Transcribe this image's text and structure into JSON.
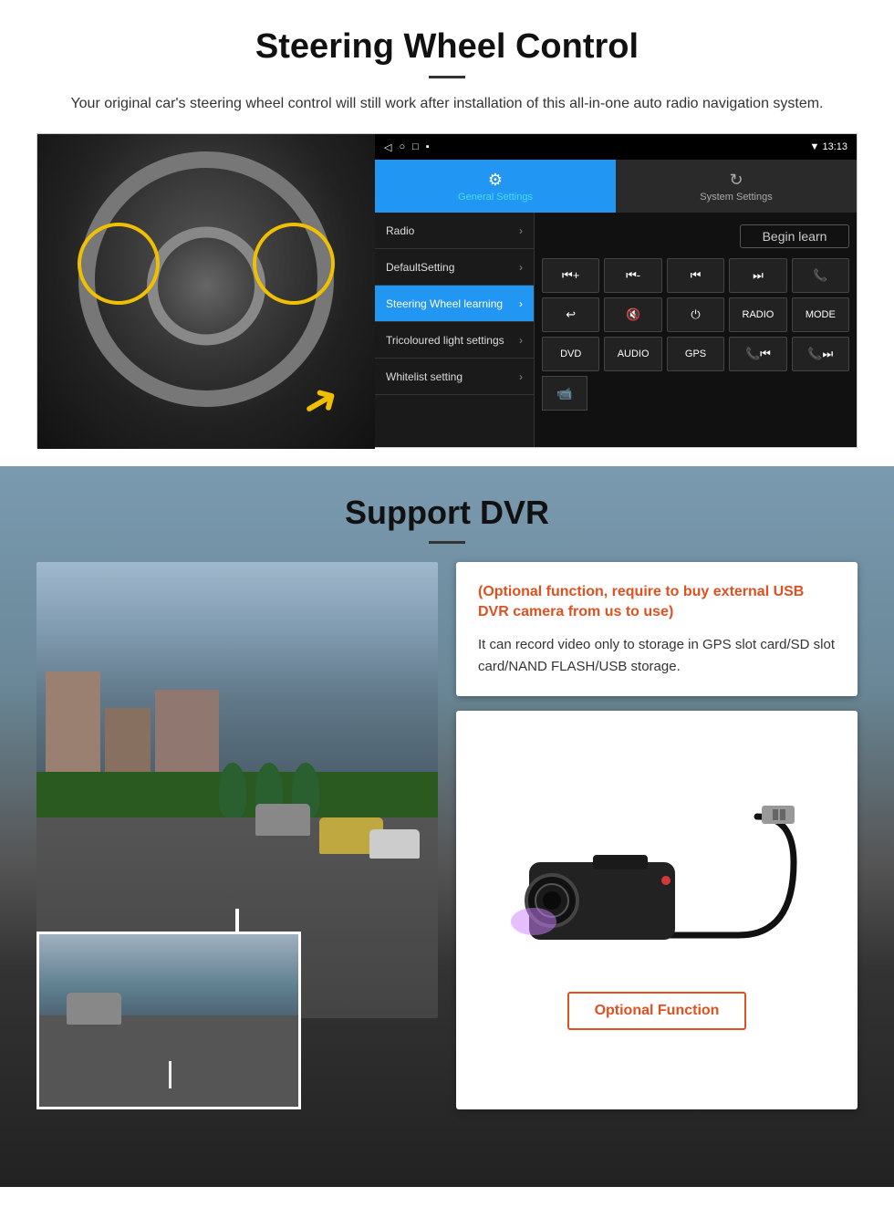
{
  "steering": {
    "title": "Steering Wheel Control",
    "description": "Your original car's steering wheel control will still work after installation of this all-in-one auto radio navigation system.",
    "ui": {
      "status_bar": {
        "icons": "◁  ○  □  ▪",
        "time": "13:13",
        "signal": "▼"
      },
      "tabs": [
        {
          "label": "General Settings",
          "icon": "⚙",
          "active": true
        },
        {
          "label": "System Settings",
          "icon": "🔄",
          "active": false
        }
      ],
      "menu_items": [
        {
          "label": "Radio",
          "active": false
        },
        {
          "label": "DefaultSetting",
          "active": false
        },
        {
          "label": "Steering Wheel learning",
          "active": true
        },
        {
          "label": "Tricoloured light settings",
          "active": false
        },
        {
          "label": "Whitelist setting",
          "active": false
        }
      ],
      "begin_learn": "Begin learn",
      "control_buttons": {
        "row1": [
          "⏮+",
          "⏮-",
          "⏮",
          "⏭",
          "📞"
        ],
        "row2": [
          "↩",
          "🔇",
          "⏻",
          "RADIO",
          "MODE"
        ],
        "row3": [
          "DVD",
          "AUDIO",
          "GPS",
          "📞⏮",
          "📞⏭"
        ],
        "row4_icon": "📹"
      }
    }
  },
  "dvr": {
    "title": "Support DVR",
    "optional_heading": "(Optional function, require to buy external USB DVR camera from us to use)",
    "info_text": "It can record video only to storage in GPS slot card/SD slot card/NAND FLASH/USB storage.",
    "optional_function_label": "Optional Function"
  }
}
